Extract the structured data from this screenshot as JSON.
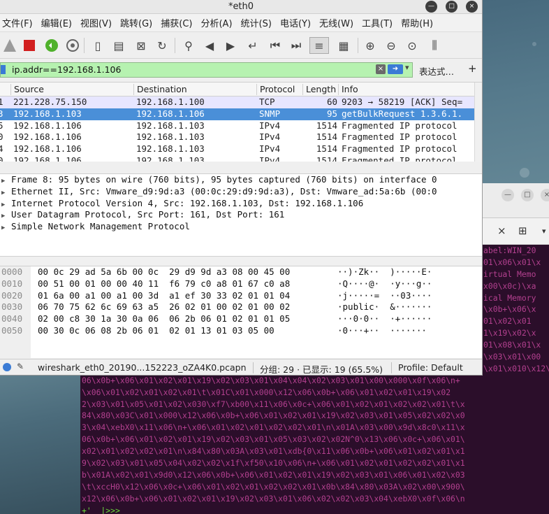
{
  "wireshark": {
    "title": "*eth0",
    "menu": [
      "文件(F)",
      "编辑(E)",
      "视图(V)",
      "跳转(G)",
      "捕获(C)",
      "分析(A)",
      "统计(S)",
      "电话(Y)",
      "无线(W)",
      "工具(T)",
      "帮助(H)"
    ],
    "filter": {
      "value": "ip.addr==192.168.1.106",
      "expression_button": "表达式…",
      "add_button": "+"
    },
    "packet_list": {
      "columns": [
        "Source",
        "Destination",
        "Protocol",
        "Length",
        "Info"
      ],
      "rows": [
        {
          "no": "1",
          "source": "221.228.75.150",
          "destination": "192.168.1.100",
          "protocol": "TCP",
          "length": "60",
          "info": "9203 → 58219 [ACK] Seq=",
          "style": "tcp"
        },
        {
          "no": "3",
          "source": "192.168.1.103",
          "destination": "192.168.1.106",
          "protocol": "SNMP",
          "length": "95",
          "info": "getBulkRequest 1.3.6.1.",
          "style": "sel"
        },
        {
          "no": "5",
          "source": "192.168.1.106",
          "destination": "192.168.1.103",
          "protocol": "IPv4",
          "length": "1514",
          "info": "Fragmented IP protocol",
          "style": "white"
        },
        {
          "no": "0",
          "source": "192.168.1.106",
          "destination": "192.168.1.103",
          "protocol": "IPv4",
          "length": "1514",
          "info": "Fragmented IP protocol",
          "style": "white"
        },
        {
          "no": "4",
          "source": "192.168.1.106",
          "destination": "192.168.1.103",
          "protocol": "IPv4",
          "length": "1514",
          "info": "Fragmented IP protocol",
          "style": "white"
        },
        {
          "no": "0",
          "source": "192.168.1.106",
          "destination": "192.168.1.103",
          "protocol": "IPv4",
          "length": "1514",
          "info": "Fragmented IP protocol",
          "style": "white"
        }
      ]
    },
    "details": [
      "Frame 8: 95 bytes on wire (760 bits), 95 bytes captured (760 bits) on interface 0",
      "Ethernet II, Src: Vmware_d9:9d:a3 (00:0c:29:d9:9d:a3), Dst: Vmware_ad:5a:6b (00:0",
      "Internet Protocol Version 4, Src: 192.168.1.103, Dst: 192.168.1.106",
      "User Datagram Protocol, Src Port: 161, Dst Port: 161",
      "Simple Network Management Protocol"
    ],
    "hex": [
      {
        "offset": "0000",
        "bytes": "00 0c 29 ad 5a 6b 00 0c  29 d9 9d a3 08 00 45 00",
        "ascii": "··)·Zk··  )·····E·"
      },
      {
        "offset": "0010",
        "bytes": "00 51 00 01 00 00 40 11  f6 79 c0 a8 01 67 c0 a8",
        "ascii": "·Q····@·  ·y···g··"
      },
      {
        "offset": "0020",
        "bytes": "01 6a 00 a1 00 a1 00 3d  a1 ef 30 33 02 01 01 04",
        "ascii": "·j·····=  ··03····"
      },
      {
        "offset": "0030",
        "bytes": "06 70 75 62 6c 69 63 a5  26 02 01 00 02 01 00 02",
        "ascii": "·public·  &·······"
      },
      {
        "offset": "0040",
        "bytes": "02 00 c8 30 1a 30 0a 06  06 2b 06 01 02 01 01 05",
        "ascii": "···0·0··  ·+······"
      },
      {
        "offset": "0050",
        "bytes": "00 30 0c 06 08 2b 06 01  02 01 13 01 03 05 00",
        "ascii": "·0···+··  ·······"
      }
    ],
    "status": {
      "file": "wireshark_eth0_20190...152223_oZA4K0.pcapn",
      "packets": "分组: 29 · 已显示: 19 (65.5%)",
      "profile": "Profile: Default"
    }
  },
  "terminal": {
    "lines": [
      "abel:WIN_20",
      "01\\x06\\x01\\x",
      "irtual Memo",
      "x00\\x0c)\\xa",
      "ical Memory",
      "\\x0b+\\x06\\x",
      "01\\x02\\x01",
      "1\\x19\\x02\\x",
      "01\\x08\\x01\\x",
      "\\x03\\x01\\x00",
      "\\x01\\x010\\x12\\",
      "06\\x0b+\\x06\\x01\\x02\\x01\\x19\\x02\\x03\\x01\\x04\\x04\\x02\\x03\\x01\\x00\\x000\\x0f\\x06\\n+",
      "\\x06\\x01\\x02\\x01\\x02\\x01\\t\\x01C\\x01\\x000\\x12\\x06\\x0b+\\x06\\x01\\x02\\x01\\x19\\x02",
      "2\\x03\\x01\\x05\\x01\\x02\\x030\\xf7\\xb00\\x11\\x06\\x0c+\\x06\\x01\\x02\\x01\\x02\\x02\\x01\\t\\x",
      "84\\x80\\x03C\\x01\\x000\\x12\\x06\\x0b+\\x06\\x01\\x02\\x01\\x19\\x02\\x03\\x01\\x05\\x02\\x02\\x0",
      "3\\x04\\xebX0\\x11\\x06\\n+\\x06\\x01\\x02\\x01\\x02\\x02\\x01\\n\\x01A\\x03\\x00\\x9d\\x8c0\\x11\\x",
      "06\\x0b+\\x06\\x01\\x02\\x01\\x19\\x02\\x03\\x01\\x05\\x03\\x02\\x02N^0\\x13\\x06\\x0c+\\x06\\x01\\",
      "x02\\x01\\x02\\x02\\x01\\n\\x84\\x80\\x03A\\x03\\x01\\xdb{0\\x11\\x06\\x0b+\\x06\\x01\\x02\\x01\\x1",
      "9\\x02\\x03\\x01\\x05\\x04\\x02\\x02\\x1f\\xf50\\x10\\x06\\n+\\x06\\x01\\x02\\x01\\x02\\x02\\x01\\x1",
      "b\\x01A\\x02\\x01\\x9d0\\x12\\x06\\x0b+\\x06\\x01\\x02\\x01\\x19\\x02\\x03\\x01\\x06\\x01\\x02\\x03",
      "\\t\\xccH0\\x12\\x06\\x0c+\\x06\\x01\\x02\\x01\\x02\\x02\\x01\\x0b\\x84\\x80\\x03A\\x02\\x00\\x900\\",
      "x12\\x06\\x0b+\\x06\\x01\\x02\\x01\\x19\\x02\\x03\\x01\\x06\\x02\\x02\\x03\\x04\\xebX0\\x0f\\x06\\n",
      "+'  |>>>"
    ]
  }
}
